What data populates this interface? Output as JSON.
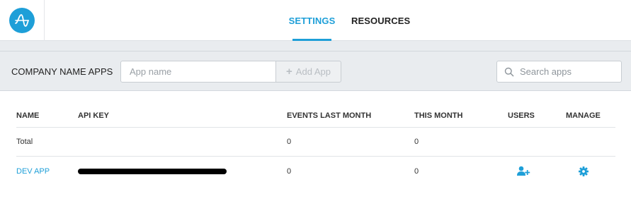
{
  "nav": {
    "logo": "amplitude-logo-icon",
    "tabs": [
      {
        "label": "SETTINGS",
        "active": true
      },
      {
        "label": "RESOURCES",
        "active": false
      }
    ]
  },
  "panel": {
    "title": "COMPANY NAME APPS",
    "app_name_placeholder": "App name",
    "add_app_label": "Add App",
    "search_placeholder": "Search apps"
  },
  "table": {
    "columns": [
      "NAME",
      "API KEY",
      "EVENTS LAST MONTH",
      "THIS MONTH",
      "USERS",
      "MANAGE"
    ],
    "rows": [
      {
        "name": "Total",
        "api_key": "",
        "events_last_month": "0",
        "this_month": "0"
      },
      {
        "name": "DEV APP",
        "api_key": "[redacted]",
        "events_last_month": "0",
        "this_month": "0",
        "users_icon": "add-user-icon",
        "manage_icon": "gear-icon"
      }
    ]
  },
  "colors": {
    "accent": "#1e9fd8",
    "page_bg": "#e9ecef",
    "text": "#333333",
    "disabled": "#b9bec3"
  }
}
